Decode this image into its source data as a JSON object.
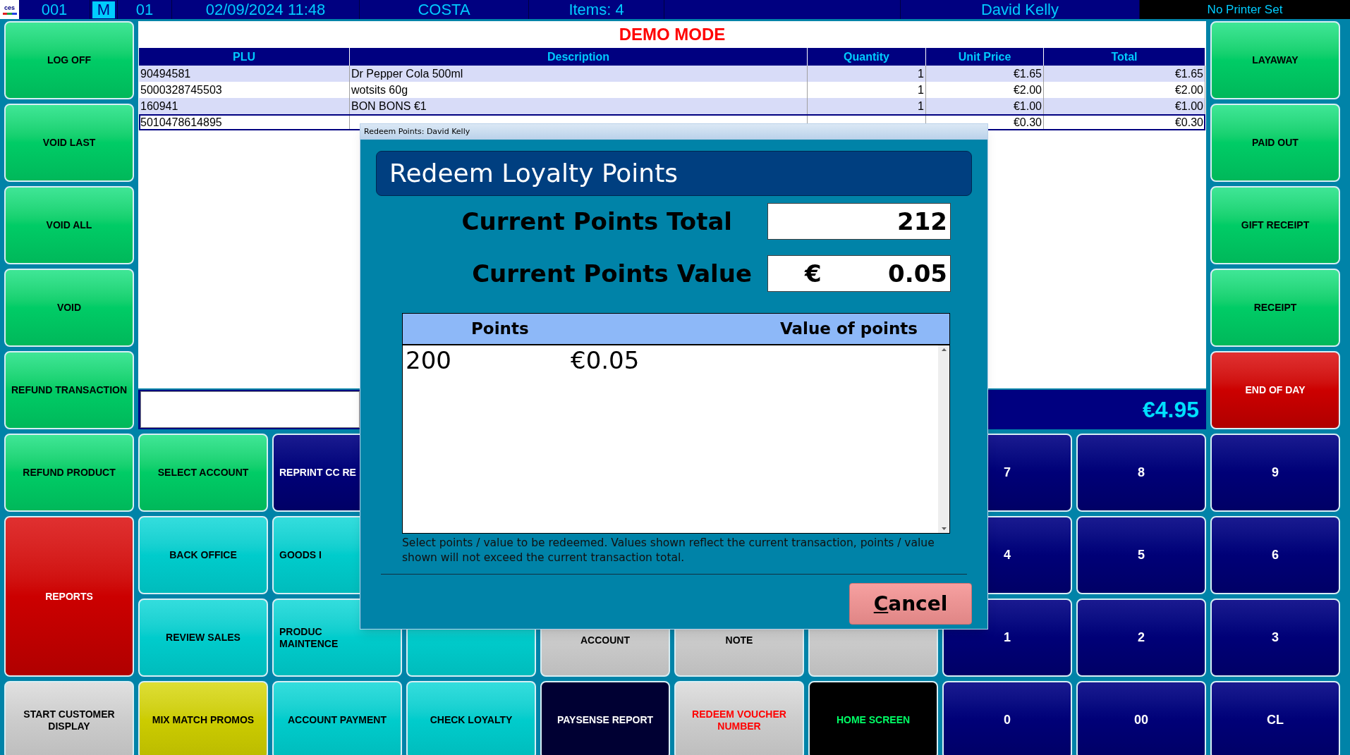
{
  "status_bar": {
    "logo": "ces",
    "terminal": "001",
    "mode": {
      "label": "M",
      "selected": true
    },
    "till": "01",
    "datetime": "02/09/2024 11:48",
    "store": "COSTA",
    "items": "Items: 4",
    "operator": "David Kelly",
    "printer": "No Printer Set"
  },
  "banner": "DEMO MODE",
  "table": {
    "columns": [
      "PLU",
      "Description",
      "Quantity",
      "Unit Price",
      "Total"
    ],
    "rows": [
      {
        "plu": "90494581",
        "description": "Dr Pepper Cola 500ml",
        "quantity": "1",
        "unit_price": "€1.65",
        "total": "€1.65",
        "selected": false
      },
      {
        "plu": "5000328745503",
        "description": "wotsits 60g",
        "quantity": "1",
        "unit_price": "€2.00",
        "total": "€2.00",
        "selected": false
      },
      {
        "plu": "160941",
        "description": "BON BONS €1",
        "quantity": "1",
        "unit_price": "€1.00",
        "total": "€1.00",
        "selected": false
      },
      {
        "plu": "5010478614895",
        "unit_price": "€0.30",
        "total": "€0.30",
        "selected": true
      }
    ]
  },
  "total": "€4.95",
  "left_buttons": [
    {
      "label": "LOG OFF",
      "kind": "green",
      "tall": false
    },
    {
      "label": "VOID LAST",
      "kind": "green",
      "tall": false
    },
    {
      "label": "VOID ALL",
      "kind": "green",
      "tall": false
    },
    {
      "label": "VOID",
      "kind": "green",
      "tall": false
    },
    {
      "label": "REFUND TRANSACTION",
      "kind": "green",
      "tall": false
    },
    {
      "label": "REFUND PRODUCT",
      "kind": "green",
      "tall": false
    },
    {
      "label": "REPORTS",
      "kind": "red",
      "tall": true
    },
    {
      "label": "START CUSTOMER DISPLAY",
      "kind": "grey",
      "tall": false
    }
  ],
  "right_buttons": [
    {
      "label": "LAYAWAY",
      "kind": "green"
    },
    {
      "label": "PAID OUT",
      "kind": "green"
    },
    {
      "label": "GIFT RECEIPT",
      "kind": "green"
    },
    {
      "label": "RECEIPT",
      "kind": "green"
    },
    {
      "label": "END OF DAY",
      "kind": "red"
    }
  ],
  "function_rows": [
    [
      {
        "label": "SELECT ACCOUNT",
        "kind": "green",
        "clipped": false
      },
      {
        "label": "REPRINT CC RE",
        "kind": "navy",
        "clipped": true
      }
    ],
    [
      {
        "label": "BACK OFFICE",
        "kind": "cyan",
        "clipped": false
      },
      {
        "label": "GOODS I",
        "kind": "cyan",
        "clipped": true
      }
    ],
    [
      {
        "label": "REVIEW SALES",
        "kind": "cyan",
        "clipped": false
      },
      {
        "label": "PRODUC\nMAINTENCE",
        "kind": "cyan",
        "clipped": true
      },
      {
        "kind": "cyan"
      },
      {
        "label": "ACCOUNT",
        "kind": "grey",
        "clipped": false
      },
      {
        "label": "NOTE",
        "kind": "grey",
        "clipped": false
      },
      {
        "kind": "grey"
      }
    ],
    [
      {
        "label": "MIX MATCH PROMOS",
        "kind": "yellow",
        "clipped": false
      },
      {
        "label": "ACCOUNT PAYMENT",
        "kind": "cyan",
        "clipped": false
      },
      {
        "label": "CHECK LOYALTY",
        "kind": "cyan",
        "clipped": false
      },
      {
        "label": "PAYSENSE REPORT",
        "kind": "dark",
        "clipped": false
      },
      {
        "label": "REDEEM VOUCHER NUMBER",
        "kind": "alert",
        "clipped": false
      },
      {
        "label": "HOME SCREEN",
        "kind": "black",
        "clipped": false
      }
    ]
  ],
  "keypad": [
    "7",
    "8",
    "9",
    "4",
    "5",
    "6",
    "1",
    "2",
    "3",
    "0",
    "00",
    "CL"
  ],
  "dialog": {
    "title": "Redeem Points: David Kelly",
    "heading": "Redeem Loyalty Points",
    "points_total": {
      "label": "Current Points Total",
      "value": "212"
    },
    "points_value": {
      "label": "Current Points Value",
      "currency": "€",
      "value": "0.05"
    },
    "list": {
      "columns": [
        "Points",
        "Value of points"
      ],
      "rows": [
        {
          "points": "200",
          "value": "€0.05"
        }
      ]
    },
    "note": "Select points / value to be redeemed. Values shown reflect the current transaction, points / value shown will not exceed the current transaction total.",
    "cancel": "Cancel"
  }
}
